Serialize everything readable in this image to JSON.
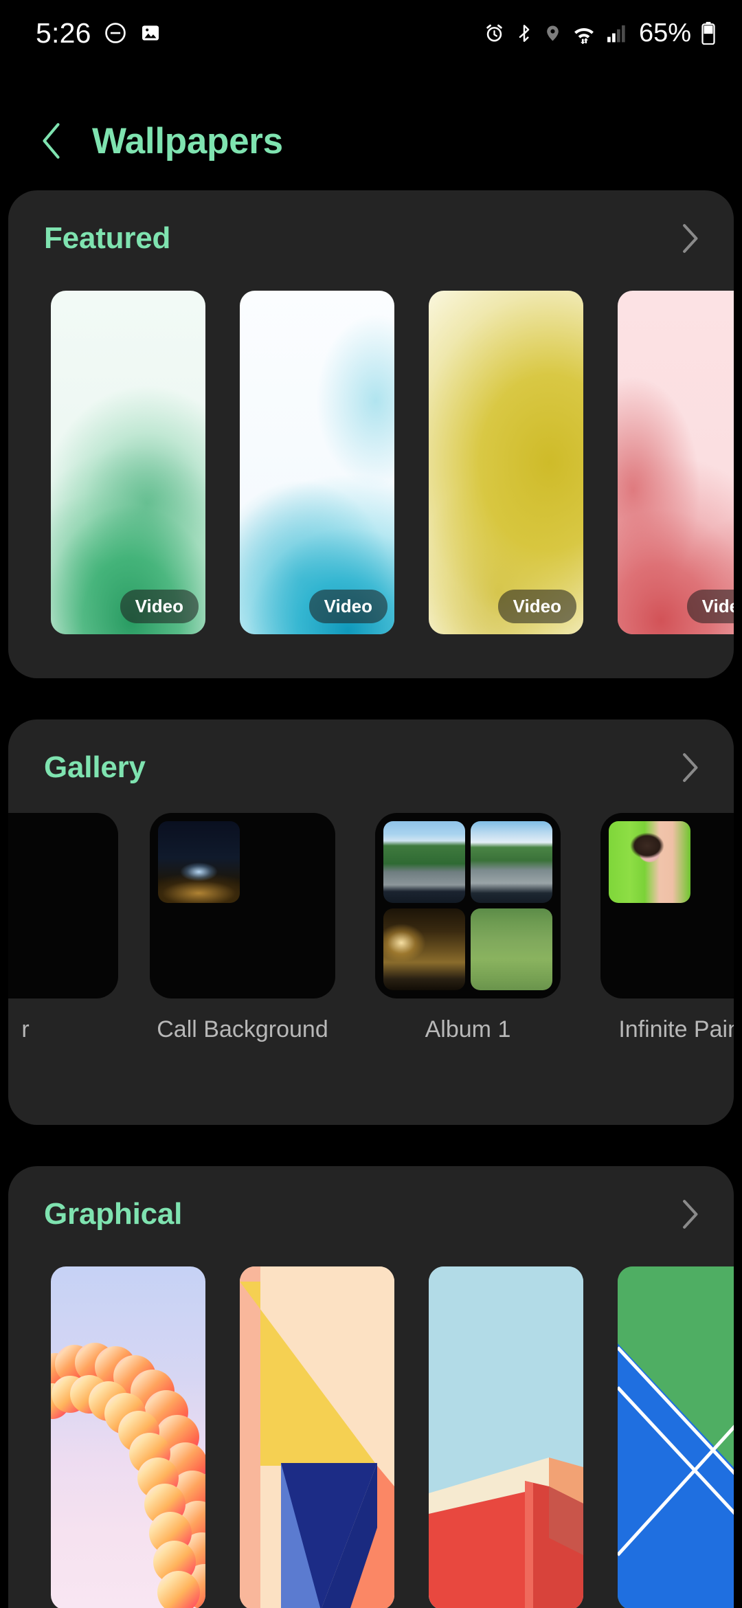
{
  "status_bar": {
    "time": "5:26",
    "left_icons": [
      "do-not-disturb-icon",
      "screenshot-image-icon"
    ],
    "right_icons": [
      "alarm-icon",
      "bluetooth-icon",
      "location-icon",
      "wifi-icon",
      "signal-bars-icon"
    ],
    "battery_percent": "65%"
  },
  "header": {
    "back_label": "back-chevron",
    "title": "Wallpapers"
  },
  "colors": {
    "accent_green": "#7fe3b0",
    "card_bg": "#242424",
    "page_bg": "#000000",
    "chevron_gray": "#8a8a8a",
    "label_gray": "#b8b8b8"
  },
  "sections": [
    {
      "id": "featured",
      "title": "Featured",
      "chevron": "chevron-right-icon",
      "items": [
        {
          "name": "green-particle-wallpaper",
          "badge": "Video",
          "art": "art-green"
        },
        {
          "name": "blue-particle-wallpaper",
          "badge": "Video",
          "art": "art-blue"
        },
        {
          "name": "yellow-particle-wallpaper",
          "badge": "Video",
          "art": "art-yellow"
        },
        {
          "name": "red-particle-wallpaper",
          "badge": "Video",
          "art": "art-red"
        }
      ]
    },
    {
      "id": "gallery",
      "title": "Gallery",
      "chevron": "chevron-right-icon",
      "items": [
        {
          "label": "r",
          "thumbs": 0
        },
        {
          "label": "Call Background",
          "thumbs": 1
        },
        {
          "label": "Album 1",
          "thumbs": 4
        },
        {
          "label": "Infinite Painter",
          "thumbs": 1
        }
      ]
    },
    {
      "id": "graphical",
      "title": "Graphical",
      "chevron": "chevron-right-icon",
      "items": [
        {
          "name": "cloud-arc-wallpaper"
        },
        {
          "name": "geometric-diagonal-wallpaper"
        },
        {
          "name": "rooftop-minimal-wallpaper"
        },
        {
          "name": "green-blue-lines-wallpaper"
        }
      ]
    }
  ]
}
